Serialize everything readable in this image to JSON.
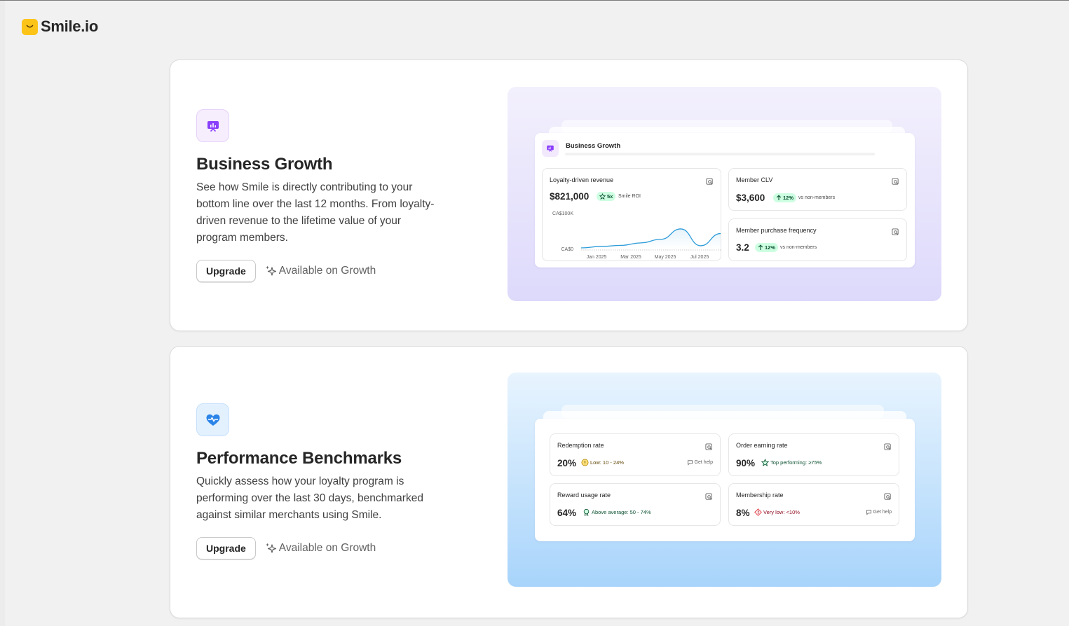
{
  "brand": {
    "name": "Smile.io",
    "logo_color": "#fcc419"
  },
  "colors": {
    "accent_purple": "#8a3ffc",
    "accent_blue": "#2b84e8",
    "success": "#0c5132",
    "warning": "#5e4200",
    "critical": "#8e0b21"
  },
  "features": [
    {
      "icon": "chart-presentation-icon",
      "title": "Business Growth",
      "description": "See how Smile is directly contributing to your bottom line over the last 12 months. From loyalty-driven revenue to the lifetime value of your program members.",
      "upgrade_label": "Upgrade",
      "availability_label": "Available on Growth",
      "preview": {
        "panel_title": "Business Growth",
        "revenue": {
          "label": "Loyalty-driven revenue",
          "value": "$821,000",
          "badge": "5x",
          "note": "Smile ROI",
          "chart_data": {
            "type": "line",
            "x": [
              "Jan 2025",
              "Feb 2025",
              "Mar 2025",
              "Apr 2025",
              "May 2025",
              "Jun 2025",
              "Jul 2025",
              "Aug 2025"
            ],
            "values": [
              2,
              6,
              9,
              16,
              26,
              55,
              8,
              42
            ],
            "xticks": [
              "Jan 2025",
              "Mar 2025",
              "May 2025",
              "Jul 2025"
            ],
            "yticks": [
              "CA$100K",
              "CA$0"
            ],
            "ylim": [
              0,
              100
            ],
            "grid": false,
            "series_color": "#2b9bd8"
          }
        },
        "clv": {
          "label": "Member CLV",
          "value": "$3,600",
          "badge": "12%",
          "note": "vs non-members"
        },
        "frequency": {
          "label": "Member purchase frequency",
          "value": "3.2",
          "badge": "12%",
          "note": "vs non-members"
        }
      }
    },
    {
      "icon": "heart-pulse-icon",
      "title": "Performance Benchmarks",
      "description": "Quickly assess how your loyalty program is performing over the last 30 days, benchmarked against similar merchants using Smile.",
      "upgrade_label": "Upgrade",
      "availability_label": "Available on Growth",
      "preview": {
        "redemption": {
          "label": "Redemption rate",
          "value": "20%",
          "badge": "Low: 10 - 24%",
          "help": "Get help"
        },
        "order_earning": {
          "label": "Order earning rate",
          "value": "90%",
          "badge": "Top performing: ≥75%"
        },
        "reward_usage": {
          "label": "Reward usage rate",
          "value": "64%",
          "badge": "Above average: 50 - 74%"
        },
        "membership": {
          "label": "Membership rate",
          "value": "8%",
          "badge": "Very low: <10%",
          "help": "Get help"
        }
      }
    }
  ]
}
